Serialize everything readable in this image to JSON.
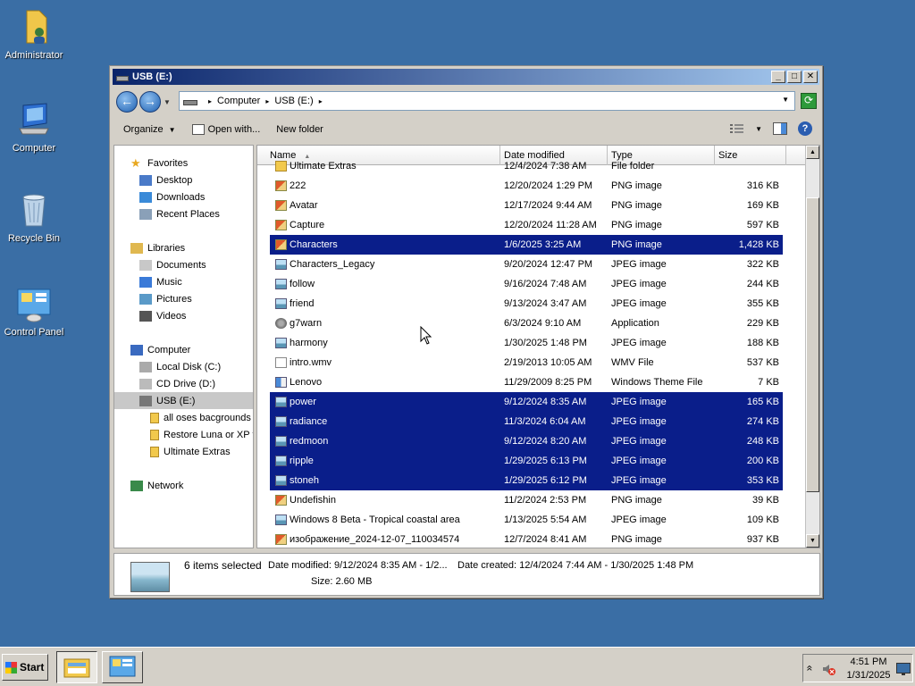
{
  "desktop": {
    "icons": [
      {
        "label": "Administrator",
        "icon": "user-folder-icon"
      },
      {
        "label": "Computer",
        "icon": "computer-icon"
      },
      {
        "label": "Recycle Bin",
        "icon": "recycle-bin-icon"
      },
      {
        "label": "Control Panel",
        "icon": "control-panel-icon"
      }
    ]
  },
  "window": {
    "title": "USB (E:)",
    "controls": {
      "minimize": "_",
      "maximize": "□",
      "close": "✕"
    },
    "address": {
      "crumbs": [
        "Computer",
        "USB (E:)"
      ]
    },
    "toolbar": {
      "organize": "Organize",
      "open_with": "Open with...",
      "new_folder": "New folder"
    }
  },
  "navpane": {
    "items": [
      {
        "label": "Favorites",
        "icon": "star-icon"
      },
      {
        "label": "Desktop",
        "icon": "desktop-icon"
      },
      {
        "label": "Downloads",
        "icon": "downloads-icon"
      },
      {
        "label": "Recent Places",
        "icon": "recent-places-icon"
      },
      {
        "label": "Libraries",
        "icon": "libraries-icon"
      },
      {
        "label": "Documents",
        "icon": "documents-icon"
      },
      {
        "label": "Music",
        "icon": "music-icon"
      },
      {
        "label": "Pictures",
        "icon": "pictures-icon"
      },
      {
        "label": "Videos",
        "icon": "videos-icon"
      },
      {
        "label": "Computer",
        "icon": "computer-icon"
      },
      {
        "label": "Local Disk (C:)",
        "icon": "drive-icon"
      },
      {
        "label": "CD Drive (D:)",
        "icon": "cd-drive-icon"
      },
      {
        "label": "USB (E:)",
        "icon": "usb-drive-icon",
        "selected": true
      },
      {
        "label": "all oses bacgrounds",
        "icon": "folder-icon"
      },
      {
        "label": "Restore Luna or XP t",
        "icon": "folder-icon"
      },
      {
        "label": "Ultimate Extras",
        "icon": "folder-icon"
      },
      {
        "label": "Network",
        "icon": "network-icon"
      }
    ]
  },
  "filelist": {
    "columns": [
      "Name",
      "Date modified",
      "Type",
      "Size"
    ],
    "rows": [
      {
        "name": "Ultimate Extras",
        "date": "12/4/2024 7:38 AM",
        "type": "File folder",
        "size": "",
        "selected": false,
        "icon": "folder-icon"
      },
      {
        "name": "222",
        "date": "12/20/2024 1:29 PM",
        "type": "PNG image",
        "size": "316 KB",
        "selected": false,
        "icon": "png-icon"
      },
      {
        "name": "Avatar",
        "date": "12/17/2024 9:44 AM",
        "type": "PNG image",
        "size": "169 KB",
        "selected": false,
        "icon": "png-icon"
      },
      {
        "name": "Capture",
        "date": "12/20/2024 11:28 AM",
        "type": "PNG image",
        "size": "597 KB",
        "selected": false,
        "icon": "png-icon"
      },
      {
        "name": "Characters",
        "date": "1/6/2025 3:25 AM",
        "type": "PNG image",
        "size": "1,428 KB",
        "selected": true,
        "icon": "png-icon"
      },
      {
        "name": "Characters_Legacy",
        "date": "9/20/2024 12:47 PM",
        "type": "JPEG image",
        "size": "322 KB",
        "selected": false,
        "icon": "jpeg-icon"
      },
      {
        "name": "follow",
        "date": "9/16/2024 7:48 AM",
        "type": "JPEG image",
        "size": "244 KB",
        "selected": false,
        "icon": "jpeg-icon"
      },
      {
        "name": "friend",
        "date": "9/13/2024 3:47 AM",
        "type": "JPEG image",
        "size": "355 KB",
        "selected": false,
        "icon": "jpeg-icon"
      },
      {
        "name": "g7warn",
        "date": "6/3/2024 9:10 AM",
        "type": "Application",
        "size": "229 KB",
        "selected": false,
        "icon": "application-icon"
      },
      {
        "name": "harmony",
        "date": "1/30/2025 1:48 PM",
        "type": "JPEG image",
        "size": "188 KB",
        "selected": false,
        "icon": "jpeg-icon"
      },
      {
        "name": "intro.wmv",
        "date": "2/19/2013 10:05 AM",
        "type": "WMV File",
        "size": "537 KB",
        "selected": false,
        "icon": "file-icon"
      },
      {
        "name": "Lenovo",
        "date": "11/29/2009 8:25 PM",
        "type": "Windows Theme File",
        "size": "7 KB",
        "selected": false,
        "icon": "theme-icon"
      },
      {
        "name": "power",
        "date": "9/12/2024 8:35 AM",
        "type": "JPEG image",
        "size": "165 KB",
        "selected": true,
        "icon": "jpeg-icon"
      },
      {
        "name": "radiance",
        "date": "11/3/2024 6:04 AM",
        "type": "JPEG image",
        "size": "274 KB",
        "selected": true,
        "icon": "jpeg-icon"
      },
      {
        "name": "redmoon",
        "date": "9/12/2024 8:20 AM",
        "type": "JPEG image",
        "size": "248 KB",
        "selected": true,
        "icon": "jpeg-icon"
      },
      {
        "name": "ripple",
        "date": "1/29/2025 6:13 PM",
        "type": "JPEG image",
        "size": "200 KB",
        "selected": true,
        "icon": "jpeg-icon"
      },
      {
        "name": "stoneh",
        "date": "1/29/2025 6:12 PM",
        "type": "JPEG image",
        "size": "353 KB",
        "selected": true,
        "icon": "jpeg-icon"
      },
      {
        "name": "Undefishin",
        "date": "11/2/2024 2:53 PM",
        "type": "PNG image",
        "size": "39 KB",
        "selected": false,
        "icon": "png-icon"
      },
      {
        "name": "Windows 8 Beta - Tropical coastal area",
        "date": "1/13/2025 5:54 AM",
        "type": "JPEG image",
        "size": "109 KB",
        "selected": false,
        "icon": "jpeg-icon"
      },
      {
        "name": "изображение_2024-12-07_110034574",
        "date": "12/7/2024 8:41 AM",
        "type": "PNG image",
        "size": "937 KB",
        "selected": false,
        "icon": "png-icon"
      }
    ]
  },
  "details": {
    "selected_count": "6 items selected",
    "date_modified": "Date modified: 9/12/2024 8:35 AM - 1/2...",
    "date_created": "Date created: 12/4/2024 7:44 AM - 1/30/2025 1:48 PM",
    "size": "Size: 2.60 MB"
  },
  "taskbar": {
    "start_label": "Start",
    "apps": [
      {
        "name": "explorer",
        "icon": "explorer-icon",
        "active": true
      },
      {
        "name": "control panel",
        "icon": "control-panel-icon",
        "active": false
      }
    ],
    "tray": {
      "time": "4:51 PM",
      "date": "1/31/2025",
      "expand": "«"
    }
  },
  "colors": {
    "desktop": "#3a6ea5",
    "selection": "#0a1e8a",
    "title_start": "#0a246a"
  }
}
